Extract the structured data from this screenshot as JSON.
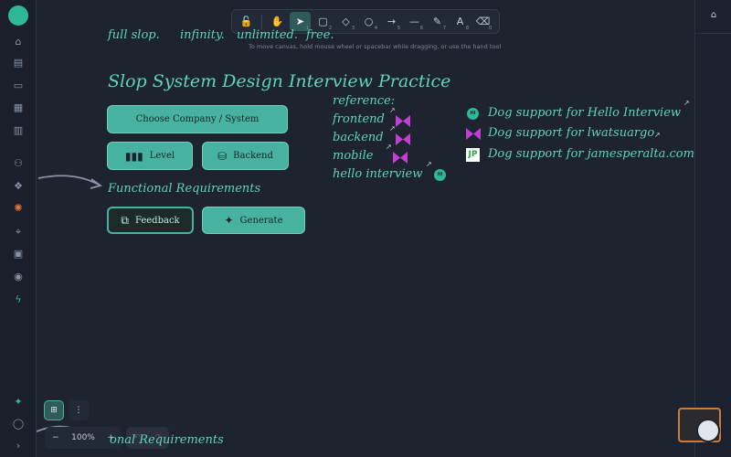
{
  "tagline": [
    "full slop.",
    "infinity.",
    "unlimited.",
    "free."
  ],
  "toolbar": {
    "tools": [
      {
        "name": "lock-tool",
        "icon": "lock-icon",
        "glyph": "🔓",
        "num": ""
      },
      {
        "name": "hand-tool",
        "icon": "hand-icon",
        "glyph": "✋",
        "num": ""
      },
      {
        "name": "select-tool",
        "icon": "pointer-icon",
        "glyph": "➤",
        "num": "1"
      },
      {
        "name": "rectangle-tool",
        "icon": "rectangle-icon",
        "glyph": "▢",
        "num": "2"
      },
      {
        "name": "diamond-tool",
        "icon": "diamond-icon",
        "glyph": "◇",
        "num": "3"
      },
      {
        "name": "ellipse-tool",
        "icon": "ellipse-icon",
        "glyph": "○",
        "num": "4"
      },
      {
        "name": "arrow-tool",
        "icon": "arrow-icon",
        "glyph": "→",
        "num": "5"
      },
      {
        "name": "line-tool",
        "icon": "line-icon",
        "glyph": "—",
        "num": "6"
      },
      {
        "name": "pencil-tool",
        "icon": "pencil-icon",
        "glyph": "✎",
        "num": "7"
      },
      {
        "name": "text-tool",
        "icon": "text-icon",
        "glyph": "A",
        "num": "8"
      },
      {
        "name": "eraser-tool",
        "icon": "eraser-icon",
        "glyph": "⌫",
        "num": "0"
      }
    ],
    "active": 2
  },
  "hint": "To move canvas, hold mouse wheel or spacebar while dragging, or use the hand tool",
  "title": "Slop System Design Interview Practice",
  "buttons": {
    "choose": "Choose Company / System",
    "level": "Level",
    "backend": "Backend",
    "feedback": "Feedback",
    "generate": "Generate"
  },
  "functional_requirements": "Functional Requirements",
  "reference": {
    "heading": "reference:",
    "items": [
      "frontend",
      "backend",
      "mobile",
      "hello interview"
    ]
  },
  "support": [
    "Dog support for Hello Interview",
    "Dog support for lwatsuargo",
    "Dog support for jamesperalta.com"
  ],
  "jp_badge": "JP",
  "hi_badge": "HI",
  "zoom": {
    "minus": "−",
    "level": "100%",
    "plus": "+"
  },
  "bottom_partial": "onal Requirements",
  "colors": {
    "accent": "#5fd3bc",
    "button": "#46b29f",
    "bowtie": "#c23fd1",
    "helper_border": "#d27a3a"
  }
}
